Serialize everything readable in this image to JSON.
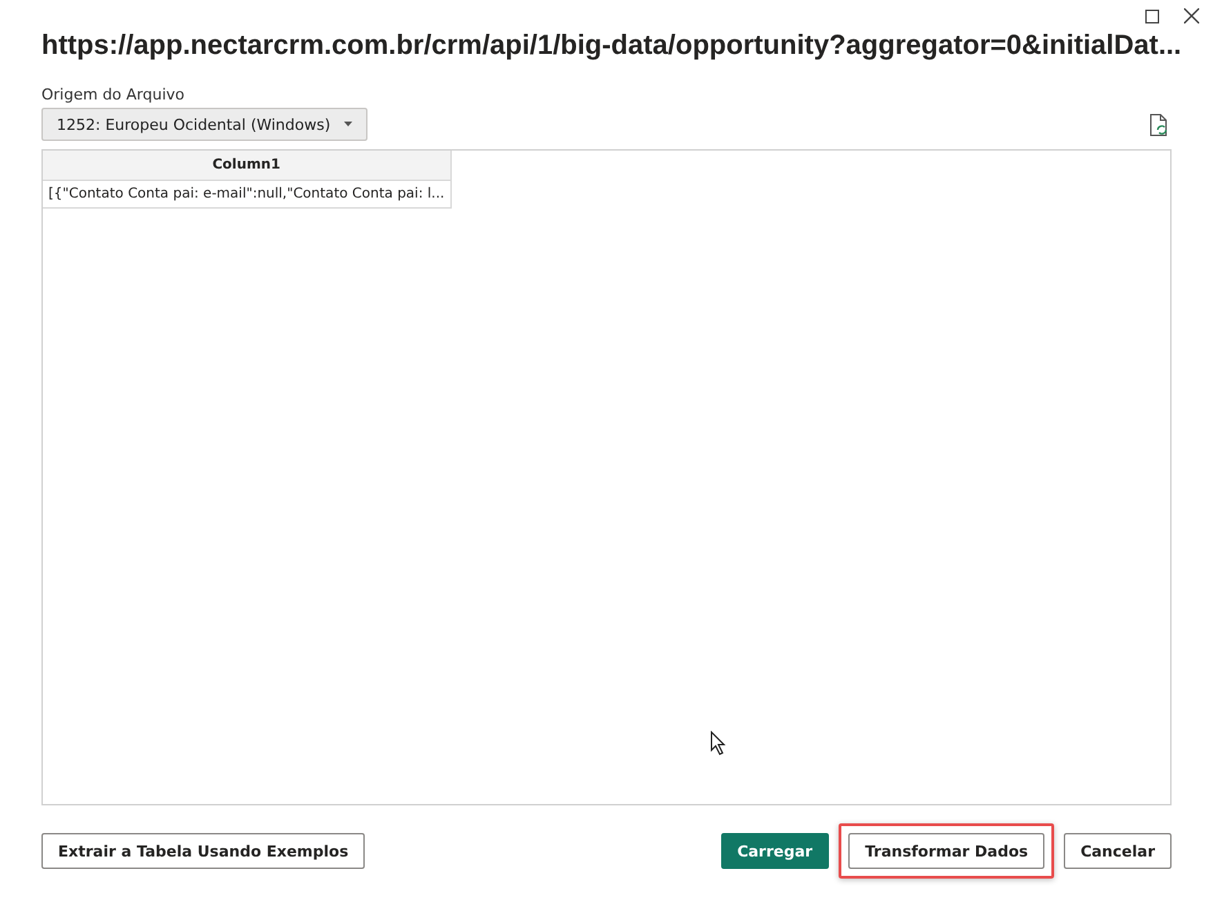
{
  "window": {
    "title": "https://app.nectarcrm.com.br/crm/api/1/big-data/opportunity?aggregator=0&initialDat..."
  },
  "file_origin": {
    "label": "Origem do Arquivo",
    "value": "1252: Europeu Ocidental (Windows)"
  },
  "table": {
    "columns": [
      "Column1"
    ],
    "rows": [
      [
        "[{\"Contato Conta pai: e-mail\":null,\"Contato Conta pai: l..."
      ]
    ]
  },
  "buttons_left": [
    {
      "label": "Extrair a Tabela Usando Exemplos",
      "kind": "secondary",
      "highlighted": false
    }
  ],
  "buttons_right": [
    {
      "label": "Carregar",
      "kind": "primary",
      "highlighted": false
    },
    {
      "label": "Transformar Dados",
      "kind": "secondary",
      "highlighted": true
    },
    {
      "label": "Cancelar",
      "kind": "secondary",
      "highlighted": false
    }
  ]
}
